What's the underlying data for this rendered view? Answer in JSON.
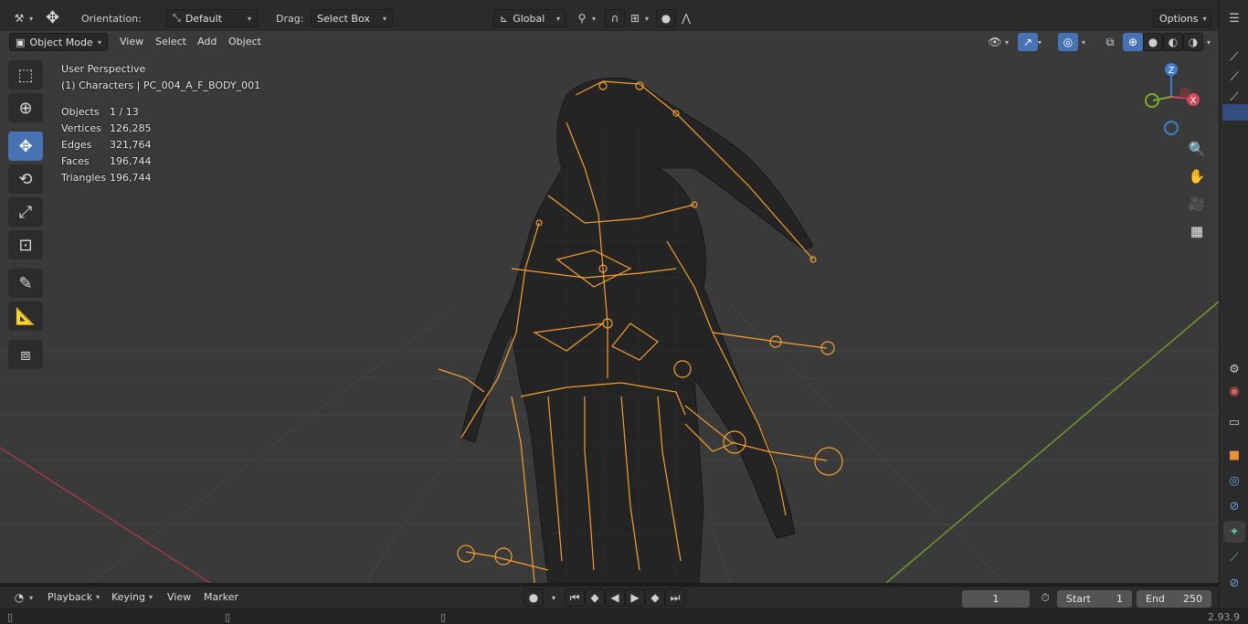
{
  "tool_header": {
    "orientation_label": "Orientation:",
    "orientation_value": "Default",
    "drag_label": "Drag:",
    "drag_value": "Select Box",
    "transform_space": "Global",
    "options_label": "Options"
  },
  "view_header": {
    "mode": "Object Mode",
    "menus": [
      "View",
      "Select",
      "Add",
      "Object"
    ]
  },
  "viewport_info": {
    "perspective": "User Perspective",
    "collection_object": "(1) Characters | PC_004_A_F_BODY_001",
    "stats": [
      {
        "label": "Objects",
        "value": "1 / 13"
      },
      {
        "label": "Vertices",
        "value": "126,285"
      },
      {
        "label": "Edges",
        "value": "321,764"
      },
      {
        "label": "Faces",
        "value": "196,744"
      },
      {
        "label": "Triangles",
        "value": "196,744"
      }
    ]
  },
  "gizmo": {
    "z": "Z",
    "x": "X"
  },
  "timeline": {
    "menus": [
      "Playback",
      "Keying",
      "View",
      "Marker"
    ],
    "current_frame": "1",
    "start_label": "Start",
    "start_value": "1",
    "end_label": "End",
    "end_value": "250"
  },
  "status": {
    "version": "2.93.9"
  },
  "colors": {
    "accent": "#4772b3",
    "armature": "#f5a030",
    "x_axis": "#9c3a48",
    "y_axis": "#6f9a2c"
  },
  "icons": {
    "tools": [
      "select-box-icon",
      "cursor-icon",
      "move-icon",
      "rotate-icon",
      "scale-icon",
      "transform-icon",
      "annotate-icon",
      "measure-icon",
      "add-cube-icon"
    ],
    "nav": [
      "zoom-icon",
      "hand-icon",
      "camera-icon",
      "grid-view-icon"
    ]
  }
}
